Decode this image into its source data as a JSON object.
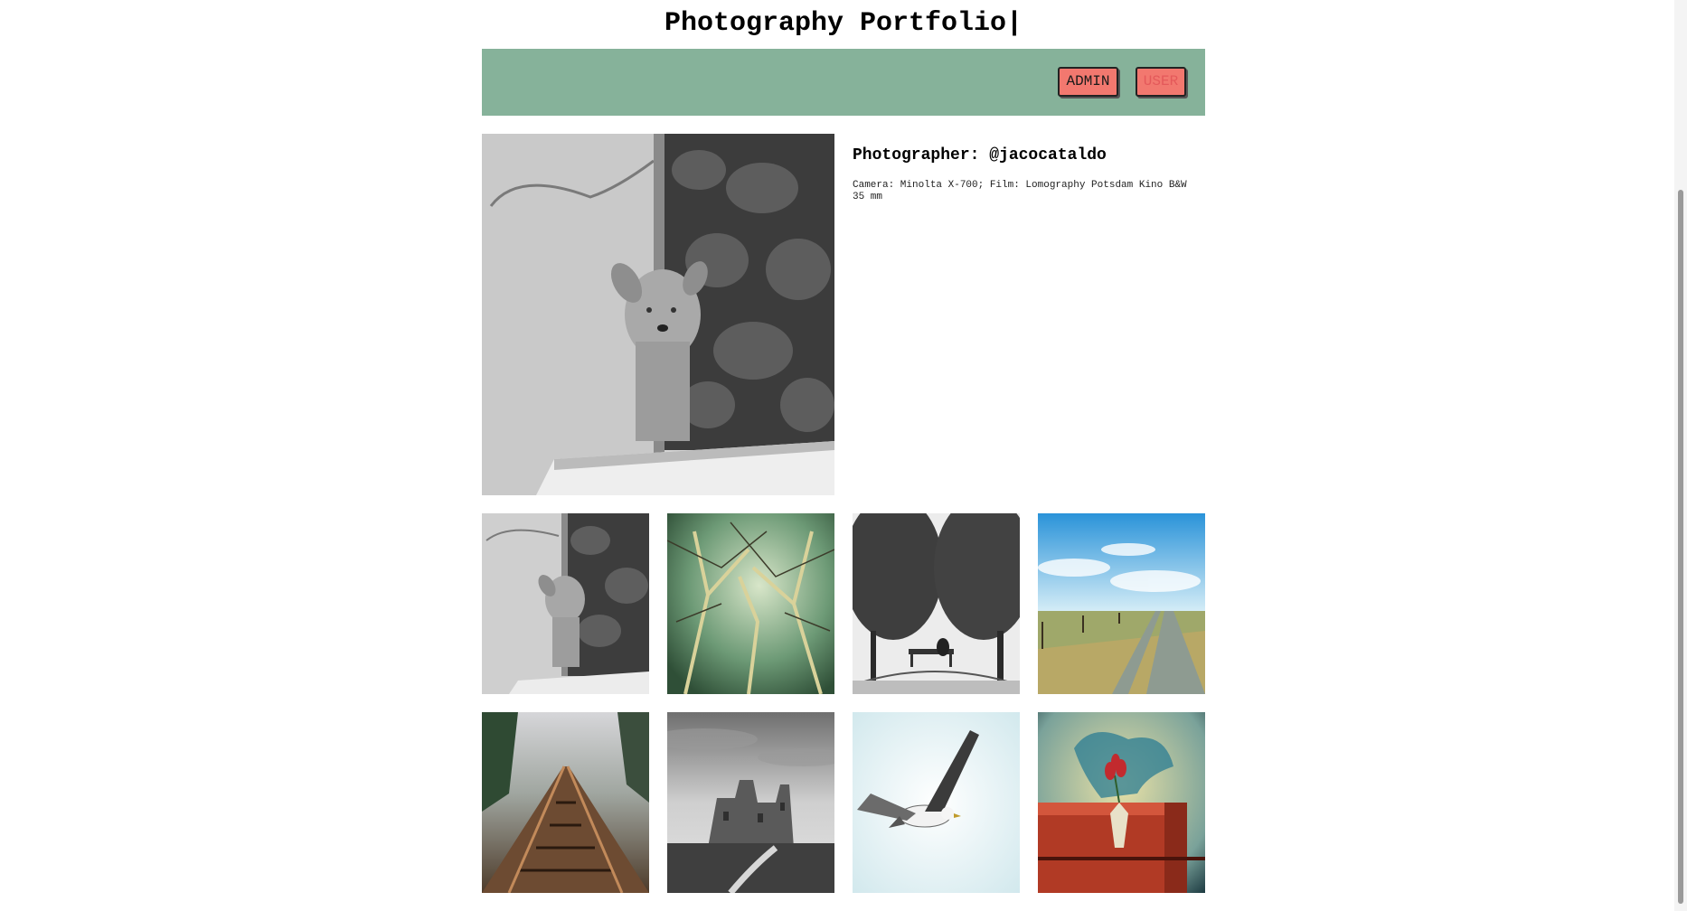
{
  "header": {
    "title": "Photography Portfolio|"
  },
  "nav": {
    "admin_label": "ADMIN",
    "user_label": "USER"
  },
  "featured": {
    "photographer": "Photographer: @jacocataldo",
    "caption": "Camera: Minolta X-700; Film: Lomography Potsdam Kino B&W 35 mm"
  },
  "colors": {
    "navbar": "#86b29a",
    "button": "#f2786f",
    "user_label": "#e4595a"
  },
  "gallery": [
    {
      "subject": "dog-window",
      "style": "bw"
    },
    {
      "subject": "trees-sky",
      "style": "green"
    },
    {
      "subject": "bench-trees",
      "style": "bw"
    },
    {
      "subject": "field-path",
      "style": "blue-sky"
    },
    {
      "subject": "railway-tracks",
      "style": "color"
    },
    {
      "subject": "ruined-castle",
      "style": "bw"
    },
    {
      "subject": "seagull-flight",
      "style": "light"
    },
    {
      "subject": "vase-flower",
      "style": "color"
    }
  ]
}
